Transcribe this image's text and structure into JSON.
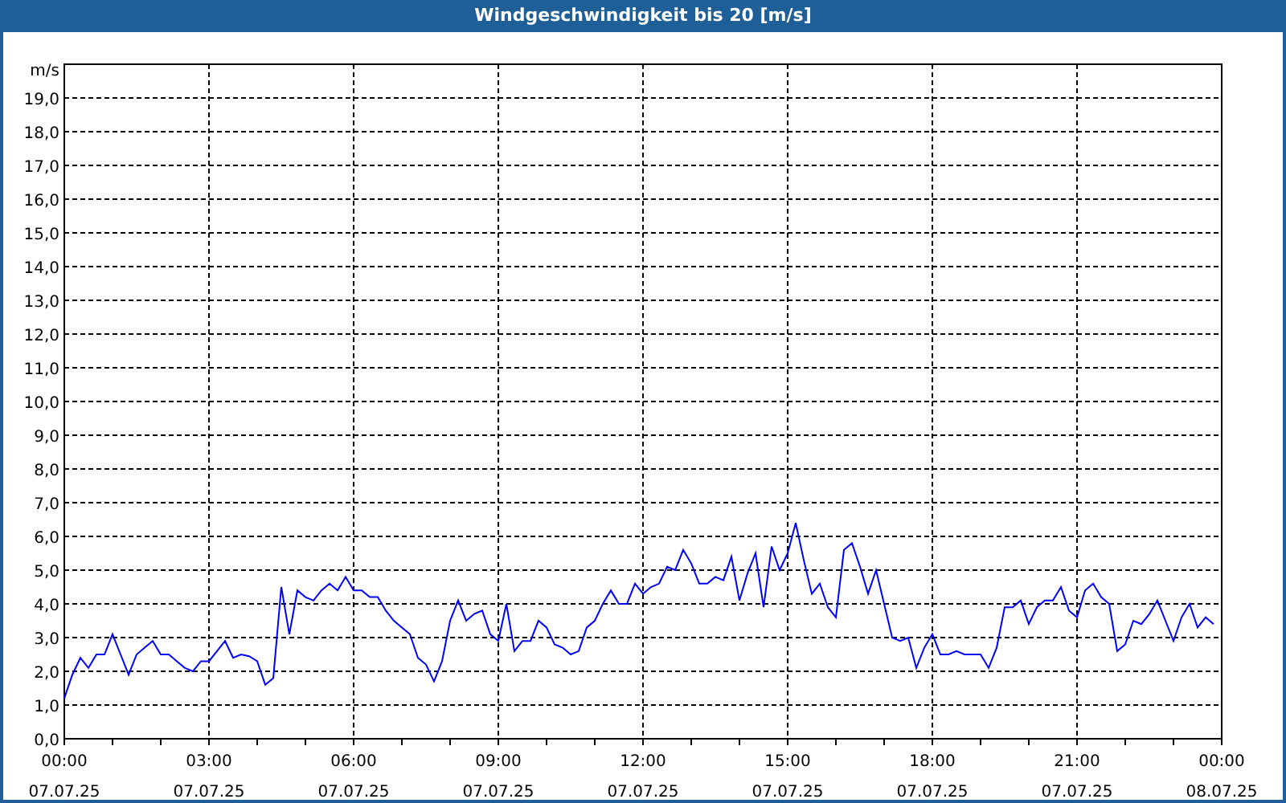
{
  "window": {
    "title": "Windgeschwindigkeit bis 20 [m/s]"
  },
  "chart": {
    "chart_data": {
      "type": "line",
      "grid": true,
      "ylabel": "m/s",
      "ylim": [
        0,
        20
      ],
      "categories": [
        "00:00\n07.07.25",
        null,
        null,
        null,
        null,
        null,
        null,
        null,
        null,
        null,
        null,
        null,
        null,
        null,
        null,
        null,
        null,
        null,
        "03:00\n07.07.25",
        null,
        null,
        null,
        null,
        null,
        null,
        null,
        null,
        null,
        null,
        null,
        null,
        null,
        null,
        null,
        null,
        null,
        "06:00\n07.07.25",
        null,
        null,
        null,
        null,
        null,
        null,
        null,
        null,
        null,
        null,
        null,
        null,
        null,
        null,
        null,
        null,
        null,
        "09:00\n07.07.25",
        null,
        null,
        null,
        null,
        null,
        null,
        null,
        null,
        null,
        null,
        null,
        null,
        null,
        null,
        null,
        null,
        null,
        "12:00\n07.07.25",
        null,
        null,
        null,
        null,
        null,
        null,
        null,
        null,
        null,
        null,
        null,
        null,
        null,
        null,
        null,
        null,
        null,
        "15:00\n07.07.25",
        null,
        null,
        null,
        null,
        null,
        null,
        null,
        null,
        null,
        null,
        null,
        null,
        null,
        null,
        null,
        null,
        null,
        "18:00\n07.07.25",
        null,
        null,
        null,
        null,
        null,
        null,
        null,
        null,
        null,
        null,
        null,
        null,
        null,
        null,
        null,
        null,
        null,
        "21:00\n07.07.25",
        null,
        null,
        null,
        null,
        null,
        null,
        null,
        null,
        null,
        null,
        null,
        null,
        null,
        null,
        null,
        null,
        null,
        "00:00\n08.07.25"
      ],
      "series": [
        {
          "color": "#0000ff",
          "values": [
            1.2,
            1.9,
            2.4,
            2.1,
            2.5,
            2.5,
            3.1,
            2.5,
            1.9,
            2.5,
            2.7,
            2.9,
            2.5,
            2.5,
            2.3,
            2.1,
            2.0,
            2.3,
            2.3,
            2.6,
            2.9,
            2.4,
            2.5,
            2.45,
            2.3,
            1.6,
            1.8,
            4.5,
            3.1,
            4.4,
            4.2,
            4.1,
            4.4,
            4.6,
            4.4,
            4.8,
            4.4,
            4.4,
            4.2,
            4.2,
            3.8,
            3.5,
            3.3,
            3.1,
            2.4,
            2.2,
            1.7,
            2.3,
            3.5,
            4.1,
            3.5,
            3.7,
            3.8,
            3.1,
            2.9,
            4.0,
            2.6,
            2.9,
            2.9,
            3.5,
            3.3,
            2.8,
            2.7,
            2.5,
            2.6,
            3.3,
            3.5,
            4.0,
            4.4,
            4.0,
            4.0,
            4.6,
            4.3,
            4.5,
            4.6,
            5.1,
            5.0,
            5.6,
            5.2,
            4.6,
            4.6,
            4.8,
            4.7,
            5.4,
            4.1,
            4.9,
            5.5,
            3.9,
            5.7,
            5.0,
            5.5,
            6.4,
            5.3,
            4.3,
            4.6,
            3.9,
            3.6,
            5.6,
            5.8,
            5.1,
            4.3,
            5.0,
            4.0,
            3.0,
            2.9,
            3.0,
            2.1,
            2.7,
            3.1,
            2.5,
            2.5,
            2.6,
            2.5,
            2.5,
            2.5,
            2.1,
            2.7,
            3.9,
            3.9,
            4.1,
            3.4,
            3.9,
            4.1,
            4.1,
            4.5,
            3.8,
            3.6,
            4.4,
            4.6,
            4.2,
            4.0,
            2.6,
            2.8,
            3.5,
            3.4,
            3.7,
            4.1,
            3.5,
            2.9,
            3.6,
            4.0,
            3.3,
            3.6,
            3.4,
            null
          ]
        }
      ],
      "yticks": [
        {
          "value": 0,
          "label": "0,0"
        },
        {
          "value": 1,
          "label": "1,0"
        },
        {
          "value": 2,
          "label": "2,0"
        },
        {
          "value": 3,
          "label": "3,0"
        },
        {
          "value": 4,
          "label": "4,0"
        },
        {
          "value": 5,
          "label": "5,0"
        },
        {
          "value": 6,
          "label": "6,0"
        },
        {
          "value": 7,
          "label": "7,0"
        },
        {
          "value": 8,
          "label": "8,0"
        },
        {
          "value": 9,
          "label": "9,0"
        },
        {
          "value": 10,
          "label": "10,0"
        },
        {
          "value": 11,
          "label": "11,0"
        },
        {
          "value": 12,
          "label": "12,0"
        },
        {
          "value": 13,
          "label": "13,0"
        },
        {
          "value": 14,
          "label": "14,0"
        },
        {
          "value": 15,
          "label": "15,0"
        },
        {
          "value": 16,
          "label": "16,0"
        },
        {
          "value": 17,
          "label": "17,0"
        },
        {
          "value": 18,
          "label": "18,0"
        },
        {
          "value": 19,
          "label": "19,0"
        }
      ]
    }
  }
}
